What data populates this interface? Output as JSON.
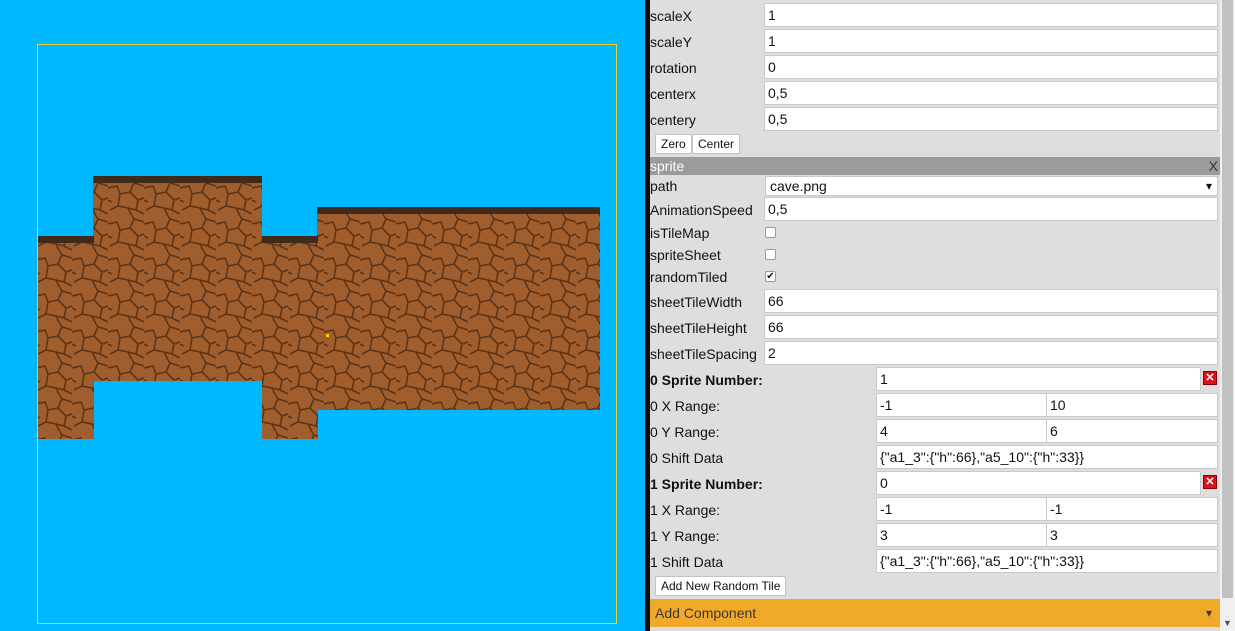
{
  "canvas": {
    "background_color": "#00b8ff",
    "bounds_color": "#e8d72a",
    "tile_colors": {
      "dirt": "#a05d2d",
      "crack": "#5d3418",
      "grass": "#3f2a1b"
    }
  },
  "transform": {
    "scaleX": {
      "label": "scaleX",
      "value": "1"
    },
    "scaleY": {
      "label": "scaleY",
      "value": "1"
    },
    "rotation": {
      "label": "rotation",
      "value": "0"
    },
    "centerx": {
      "label": "centerx",
      "value": "0,5"
    },
    "centery": {
      "label": "centery",
      "value": "0,5"
    },
    "zero_button": "Zero",
    "center_button": "Center"
  },
  "sprite": {
    "header": "sprite",
    "close_glyph": "X",
    "path_label": "path",
    "path_value": "cave.png",
    "dropdown_glyph": "▾",
    "animation_speed_label": "AnimationSpeed",
    "animation_speed_value": "0,5",
    "is_tile_map_label": "isTileMap",
    "is_tile_map_checked": false,
    "sprite_sheet_label": "spriteSheet",
    "sprite_sheet_checked": false,
    "random_tiled_label": "randomTiled",
    "random_tiled_checked": true,
    "check_glyph": "✔",
    "sheet_tile_width_label": "sheetTileWidth",
    "sheet_tile_width_value": "66",
    "sheet_tile_height_label": "sheetTileHeight",
    "sheet_tile_height_value": "66",
    "sheet_tile_spacing_label": "sheetTileSpacing",
    "sheet_tile_spacing_value": "2",
    "delete_glyph": "✕",
    "random_tiles": [
      {
        "sprite_number_label": "0 Sprite Number:",
        "sprite_number_value": "1",
        "x_range_label": "0 X Range:",
        "x_range": [
          "-1",
          "10"
        ],
        "y_range_label": "0 Y Range:",
        "y_range": [
          "4",
          "6"
        ],
        "shift_label": "0 Shift Data",
        "shift_value": "{\"a1_3\":{\"h\":66},\"a5_10\":{\"h\":33}}"
      },
      {
        "sprite_number_label": "1 Sprite Number:",
        "sprite_number_value": "0",
        "x_range_label": "1 X Range:",
        "x_range": [
          "-1",
          "-1"
        ],
        "y_range_label": "1 Y Range:",
        "y_range": [
          "3",
          "3"
        ],
        "shift_label": "1 Shift Data",
        "shift_value": "{\"a1_3\":{\"h\":66},\"a5_10\":{\"h\":33}}"
      }
    ],
    "add_random_tile_button": "Add New Random Tile"
  },
  "add_component": {
    "label": "Add Component",
    "dropdown_glyph": "▾",
    "color": "#f0a929"
  },
  "scrollbar": {
    "down_glyph": "▼"
  }
}
